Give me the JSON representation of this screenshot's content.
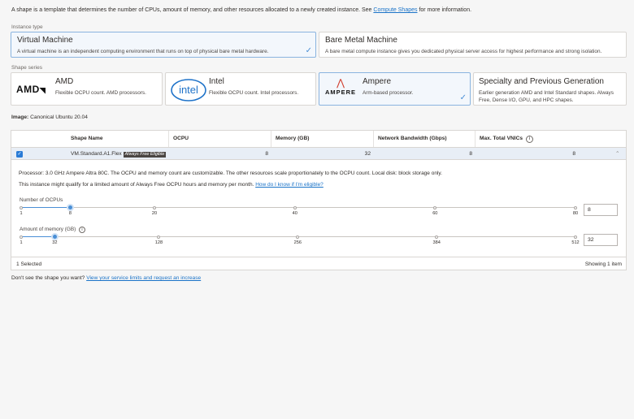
{
  "intro": {
    "text": "A shape is a template that determines the number of CPUs, amount of memory, and other resources allocated to a newly created instance. See",
    "link": "Compute Shapes",
    "suffix": "for more information."
  },
  "instance_type": {
    "label": "Instance type",
    "options": [
      {
        "title": "Virtual Machine",
        "desc": "A virtual machine is an independent computing environment that runs on top of physical bare metal hardware.",
        "selected": true
      },
      {
        "title": "Bare Metal Machine",
        "desc": "A bare metal compute instance gives you dedicated physical server access for highest performance and strong isolation.",
        "selected": false
      }
    ]
  },
  "shape_series": {
    "label": "Shape series",
    "options": [
      {
        "logo": "AMD",
        "title": "AMD",
        "desc": "Flexible OCPU count. AMD processors.",
        "selected": false
      },
      {
        "logo": "intel",
        "title": "Intel",
        "desc": "Flexible OCPU count. Intel processors.",
        "selected": false
      },
      {
        "logo": "AMPERE",
        "title": "Ampere",
        "desc": "Arm-based processor.",
        "selected": true
      },
      {
        "title": "Specialty and Previous Generation",
        "desc": "Earlier generation AMD and Intel Standard shapes. Always Free, Dense I/O, GPU, and HPC shapes.",
        "selected": false
      }
    ]
  },
  "image": {
    "label": "Image:",
    "value": "Canonical Ubuntu 20.04"
  },
  "table": {
    "headers": [
      "Shape Name",
      "OCPU",
      "Memory (GB)",
      "Network Bandwidth (Gbps)",
      "Max. Total VNICs"
    ],
    "row": {
      "shape_name": "VM.Standard.A1.Flex",
      "badge": "Always Free Eligible",
      "ocpu": "8",
      "memory": "32",
      "bandwidth": "8",
      "vnics": "8"
    },
    "details": {
      "processor": "Processor: 3.0 GHz Ampere Altra 80C. The OCPU and memory count are customizable. The other resources scale proportionately to the OCPU count. Local disk: block storage only.",
      "free_note": "This instance might qualify for a limited amount of Always Free OCPU hours and memory per month.",
      "free_link": "How do I know if I'm eligible?"
    },
    "ocpu_slider": {
      "label": "Number of OCPUs",
      "ticks": [
        "1",
        "8",
        "20",
        "40",
        "60",
        "80"
      ],
      "value": "8",
      "fraction": 0.0886
    },
    "memory_slider": {
      "label": "Amount of memory (GB)",
      "ticks": [
        "1",
        "32",
        "128",
        "256",
        "384",
        "512"
      ],
      "value": "32",
      "fraction": 0.0607
    },
    "footer_left": "1 Selected",
    "footer_right": "Showing 1 item"
  },
  "bottom": {
    "text": "Don't see the shape you want?",
    "link": "View your service limits and request an increase"
  },
  "colors": {
    "accent": "#2a7bd6",
    "selected_bg": "#f3f7fc",
    "row_bg": "#e8eef6"
  }
}
